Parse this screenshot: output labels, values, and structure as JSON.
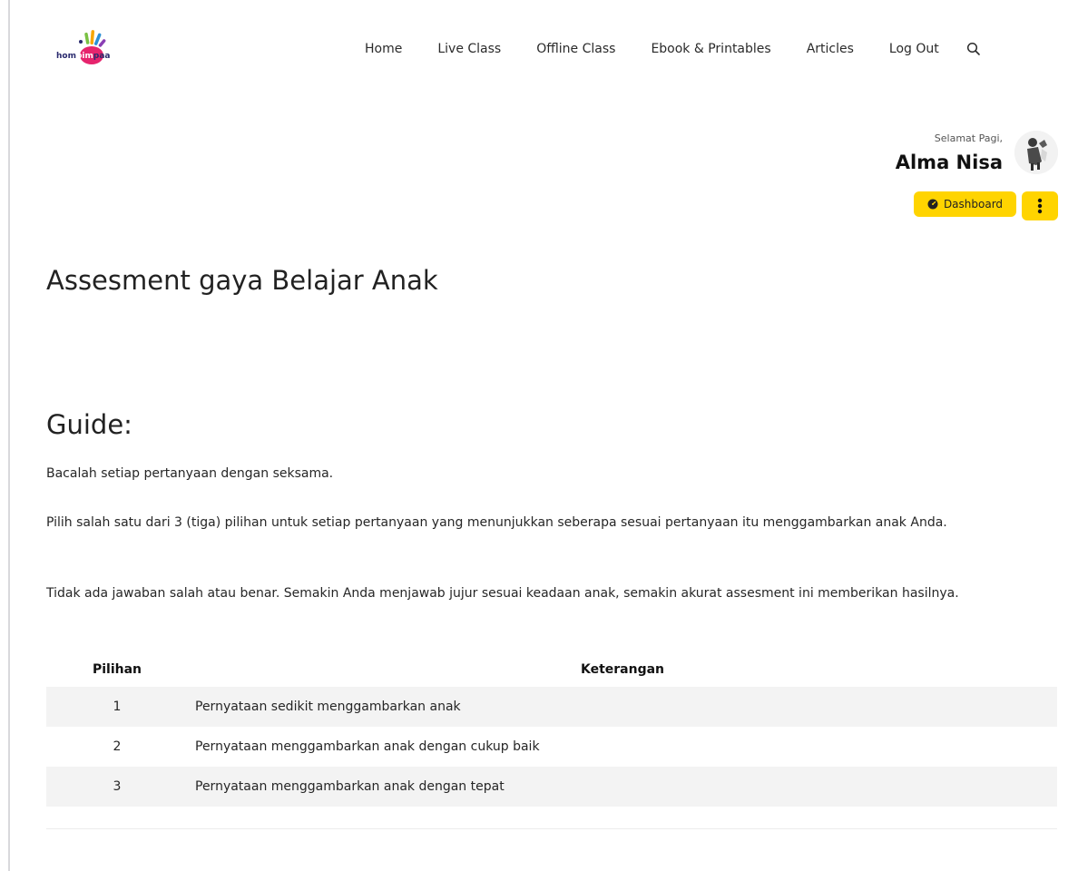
{
  "brand": {
    "logo_part1": "hom",
    "logo_part2": "pim",
    "logo_part3": "paa",
    "colors": {
      "accent": "#ffd400",
      "logo_pink": "#e6246d",
      "logo_blue": "#2a2a6e"
    }
  },
  "nav": {
    "items": [
      {
        "label": "Home"
      },
      {
        "label": "Live Class"
      },
      {
        "label": "Offline Class"
      },
      {
        "label": "Ebook & Printables"
      },
      {
        "label": "Articles"
      },
      {
        "label": "Log Out"
      }
    ],
    "search_icon": "search-icon"
  },
  "user": {
    "greeting": "Selamat Pagi,",
    "name": "Alma Nisa",
    "dashboard_label": "Dashboard",
    "dashboard_icon": "dashboard-gauge-icon",
    "more_icon": "vertical-dots-icon"
  },
  "page": {
    "title": "Assesment gaya Belajar Anak"
  },
  "guide": {
    "title": "Guide:",
    "paragraphs": [
      "Bacalah setiap pertanyaan dengan seksama.",
      "Pilih salah satu dari 3 (tiga) pilihan untuk setiap pertanyaan yang menunjukkan seberapa sesuai pertanyaan itu menggambarkan anak Anda.",
      "Tidak ada jawaban salah atau benar. Semakin Anda menjawab jujur sesuai keadaan anak, semakin akurat assesment ini memberikan hasilnya."
    ]
  },
  "table": {
    "headers": [
      "Pilihan",
      "Keterangan"
    ],
    "rows": [
      {
        "choice": "1",
        "desc": "Pernyataan sedikit menggambarkan anak"
      },
      {
        "choice": "2",
        "desc": "Pernyataan menggambarkan anak dengan cukup baik"
      },
      {
        "choice": "3",
        "desc": "Pernyataan menggambarkan anak dengan tepat"
      }
    ]
  }
}
